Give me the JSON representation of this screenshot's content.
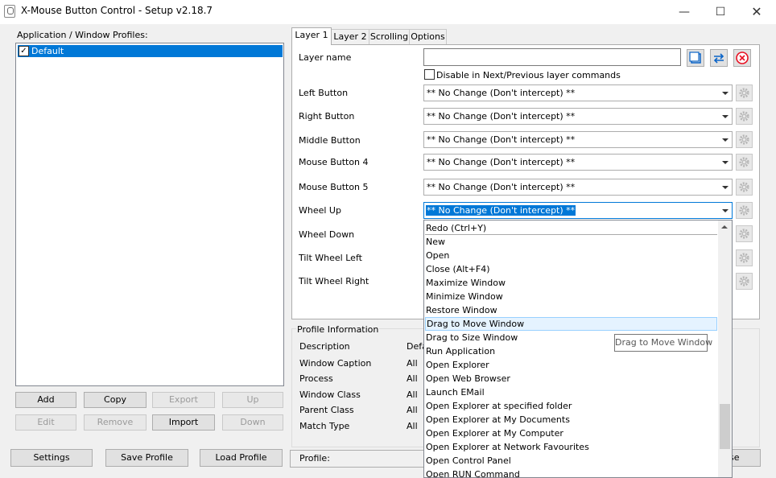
{
  "window": {
    "title": "X-Mouse Button Control - Setup v2.18.7",
    "minimize_glyph": "—",
    "maximize_glyph": "☐",
    "close_glyph": "✕"
  },
  "profiles": {
    "label": "Application / Window Profiles:",
    "items": [
      {
        "label": "Default",
        "checked": true,
        "selected": true
      }
    ],
    "buttons": {
      "add": "Add",
      "copy": "Copy",
      "export": "Export",
      "up": "Up",
      "edit": "Edit",
      "remove": "Remove",
      "import": "Import",
      "down": "Down"
    }
  },
  "tabs": [
    {
      "label": "Layer 1",
      "active": true
    },
    {
      "label": "Layer 2",
      "active": false
    },
    {
      "label": "Scrolling",
      "active": false
    },
    {
      "label": "Options",
      "active": false
    }
  ],
  "layer": {
    "name_label": "Layer name",
    "name_value": "",
    "disable_label": "Disable in Next/Previous layer commands",
    "buttons": [
      {
        "label": "Left Button",
        "value": "** No Change (Don't intercept) **"
      },
      {
        "label": "Right Button",
        "value": "** No Change (Don't intercept) **"
      },
      {
        "label": "Middle Button",
        "value": "** No Change (Don't intercept) **"
      },
      {
        "label": "Mouse Button 4",
        "value": "** No Change (Don't intercept) **"
      },
      {
        "label": "Mouse Button 5",
        "value": "** No Change (Don't intercept) **"
      },
      {
        "label": "Wheel Up",
        "value": "** No Change (Don't intercept) **"
      },
      {
        "label": "Wheel Down",
        "value": ""
      },
      {
        "label": "Tilt Wheel Left",
        "value": ""
      },
      {
        "label": "Tilt Wheel Right",
        "value": ""
      }
    ]
  },
  "dropdown": {
    "items": [
      "Redo (Ctrl+Y)",
      "New",
      "Open",
      "Close (Alt+F4)",
      "Maximize Window",
      "Minimize Window",
      "Restore Window",
      "Drag to Move Window",
      "Drag to Size Window",
      "Run Application",
      "Open Explorer",
      "Open Web Browser",
      "Launch EMail",
      "Open Explorer at specified folder",
      "Open Explorer at My Documents",
      "Open Explorer at My Computer",
      "Open Explorer at Network Favourites",
      "Open Control Panel",
      "Open RUN Command"
    ],
    "hover_index": 7,
    "tooltip": "Drag to Move Window"
  },
  "profile_info": {
    "title": "Profile Information",
    "rows": [
      {
        "label": "Description",
        "value": "Defa"
      },
      {
        "label": "Window Caption",
        "value": "All"
      },
      {
        "label": "Process",
        "value": "All"
      },
      {
        "label": "Window Class",
        "value": "All"
      },
      {
        "label": "Parent Class",
        "value": "All"
      },
      {
        "label": "Match Type",
        "value": "All"
      }
    ]
  },
  "bottom": {
    "settings": "Settings",
    "save_profile": "Save Profile",
    "load_profile": "Load Profile",
    "profile_label": "Profile:",
    "close_partial": "se"
  },
  "colors": {
    "selection": "#0078d7",
    "hover": "#e5f3ff",
    "remove_icon": "#e81123",
    "action_icon": "#0a64c8"
  }
}
